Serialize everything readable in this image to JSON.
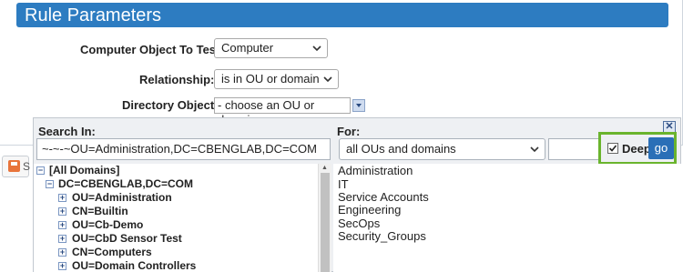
{
  "header": {
    "title": "Rule Parameters"
  },
  "form": {
    "computer_object_label": "Computer Object To Test:",
    "computer_object_value": "Computer",
    "relationship_label": "Relationship:",
    "relationship_value": "is in OU or domain",
    "directory_object_label": "Directory Object:",
    "directory_object_value": "- choose an OU or domain -"
  },
  "picker": {
    "search_in_label": "Search In:",
    "search_in_value": "~-~-~OU=Administration,DC=CBENGLAB,DC=COM",
    "for_label": "For:",
    "for_value": "all OUs and domains",
    "for_text_value": "",
    "close_label": "✕",
    "deep_label": "Deep",
    "deep_checked": true,
    "go_label": "go",
    "tree": [
      {
        "label": "[All Domains]",
        "level": 0,
        "expander": "−"
      },
      {
        "label": "DC=CBENGLAB,DC=COM",
        "level": 1,
        "expander": "−"
      },
      {
        "label": "OU=Administration",
        "level": 2,
        "expander": "+"
      },
      {
        "label": "CN=Builtin",
        "level": 2,
        "expander": "+"
      },
      {
        "label": "OU=Cb-Demo",
        "level": 2,
        "expander": "+"
      },
      {
        "label": "OU=CbD Sensor Test",
        "level": 2,
        "expander": "+"
      },
      {
        "label": "CN=Computers",
        "level": 2,
        "expander": "+"
      },
      {
        "label": "OU=Domain Controllers",
        "level": 2,
        "expander": "+"
      }
    ],
    "results": [
      "Administration",
      "IT",
      "Service Accounts",
      "Engineering",
      "SecOps",
      "Security_Groups"
    ]
  },
  "footer": {
    "save_partial": "S"
  },
  "colors": {
    "header": "#2d7cc1",
    "go": "#2a6fb7",
    "highlight": "#6ab42d",
    "save_icon": "#e8743b"
  }
}
